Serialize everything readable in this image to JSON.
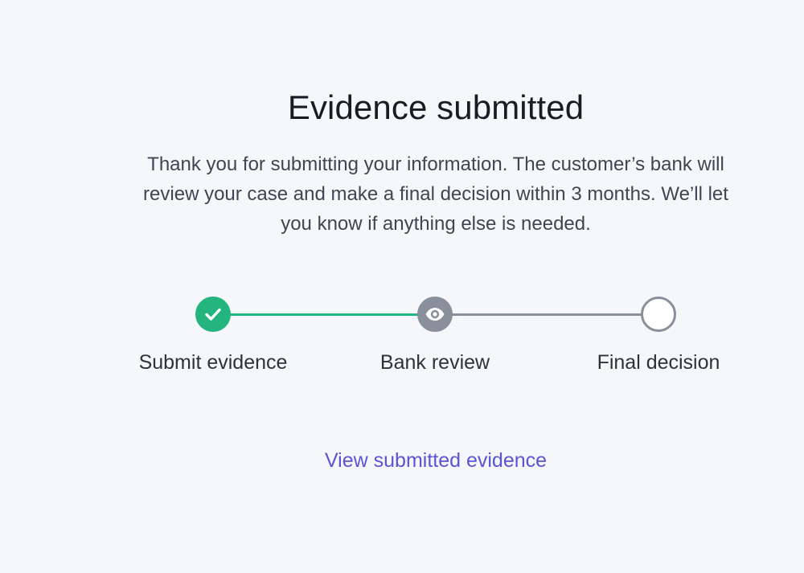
{
  "page": {
    "title": "Evidence submitted",
    "message": "Thank you for submitting your information. The customer’s bank will review your case and make a final decision within 3 months. We’ll let you know if anything else is needed."
  },
  "stepper": {
    "steps": [
      {
        "label": "Submit evidence",
        "status": "complete",
        "icon": "check-icon"
      },
      {
        "label": "Bank review",
        "status": "current",
        "icon": "eye-icon"
      },
      {
        "label": "Final decision",
        "status": "upcoming",
        "icon": "empty-circle-icon"
      }
    ]
  },
  "actions": {
    "view_evidence_label": "View submitted evidence"
  },
  "colors": {
    "background": "#f5f7fa",
    "success": "#24b47e",
    "pending": "#8a8f9c",
    "link": "#5b55d6",
    "heading": "#1a1b25",
    "body_text": "#414552"
  }
}
